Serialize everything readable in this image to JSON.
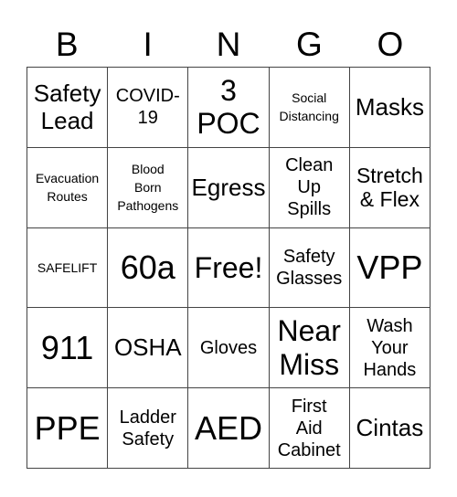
{
  "header": [
    "B",
    "I",
    "N",
    "G",
    "O"
  ],
  "cells": [
    [
      {
        "text": "Safety\nLead",
        "size": "s-m"
      },
      {
        "text": "COVID-\n19",
        "size": "s-sm"
      },
      {
        "text": "3\nPOC",
        "size": "s-l"
      },
      {
        "text": "Social\nDistancing",
        "size": "s-xs"
      },
      {
        "text": "Masks",
        "size": "s-m"
      }
    ],
    [
      {
        "text": "Evacuation\nRoutes",
        "size": "s-xs"
      },
      {
        "text": "Blood\nBorn\nPathogens",
        "size": "s-xs"
      },
      {
        "text": "Egress",
        "size": "s-m"
      },
      {
        "text": "Clean\nUp\nSpills",
        "size": "s-sm"
      },
      {
        "text": "Stretch\n& Flex",
        "size": "s-ml"
      }
    ],
    [
      {
        "text": "SAFELIFT",
        "size": "s-xs"
      },
      {
        "text": "60a",
        "size": "s-xl"
      },
      {
        "text": "Free!",
        "size": "s-l"
      },
      {
        "text": "Safety\nGlasses",
        "size": "s-sm"
      },
      {
        "text": "VPP",
        "size": "s-xl"
      }
    ],
    [
      {
        "text": "911",
        "size": "s-xl"
      },
      {
        "text": "OSHA",
        "size": "s-m"
      },
      {
        "text": "Gloves",
        "size": "s-sm"
      },
      {
        "text": "Near\nMiss",
        "size": "s-l"
      },
      {
        "text": "Wash\nYour\nHands",
        "size": "s-sm"
      }
    ],
    [
      {
        "text": "PPE",
        "size": "s-xl"
      },
      {
        "text": "Ladder\nSafety",
        "size": "s-sm"
      },
      {
        "text": "AED",
        "size": "s-xl"
      },
      {
        "text": "First\nAid\nCabinet",
        "size": "s-sm"
      },
      {
        "text": "Cintas",
        "size": "s-m"
      }
    ]
  ]
}
